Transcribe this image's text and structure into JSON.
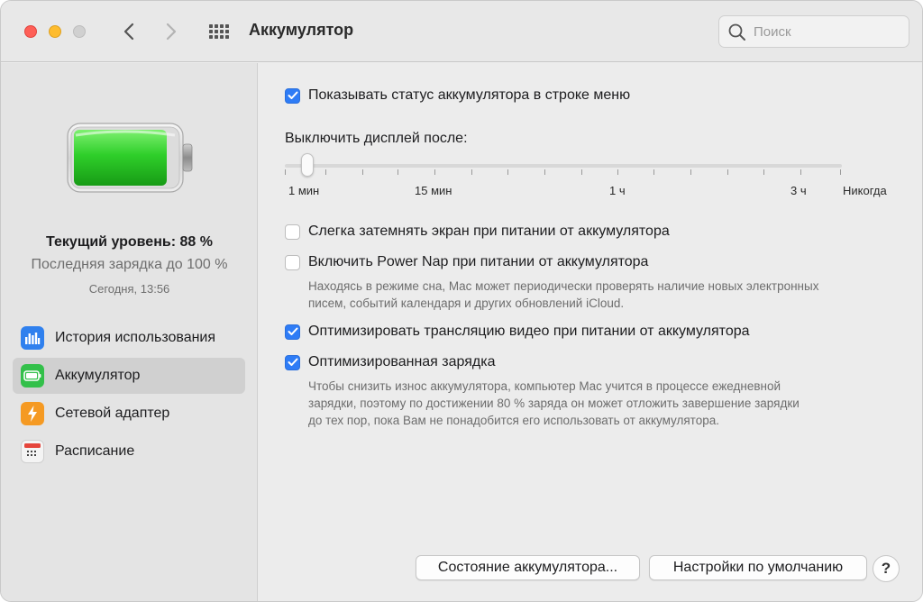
{
  "window": {
    "title": "Аккумулятор"
  },
  "search": {
    "placeholder": "Поиск",
    "value": ""
  },
  "sidebar": {
    "battery_level_percent": 88,
    "level_text": "Текущий уровень: 88 %",
    "last_charge_text": "Последняя зарядка до 100 %",
    "charge_time": "Сегодня, 13:56",
    "items": [
      {
        "label": "История использования",
        "icon": "usage-history-icon",
        "selected": false
      },
      {
        "label": "Аккумулятор",
        "icon": "battery-icon",
        "selected": true
      },
      {
        "label": "Сетевой адаптер",
        "icon": "power-adapter-icon",
        "selected": false
      },
      {
        "label": "Расписание",
        "icon": "calendar-icon",
        "selected": false
      }
    ]
  },
  "main": {
    "show_status": {
      "label": "Показывать статус аккумулятора в строке меню",
      "checked": true
    },
    "display_off": {
      "title": "Выключить дисплей после:",
      "labels": [
        "1 мин",
        "15 мин",
        "1 ч",
        "3 ч",
        "Никогда"
      ],
      "value": "1 мин"
    },
    "dim_screen": {
      "label": "Слегка затемнять экран при питании от аккумулятора",
      "checked": false
    },
    "power_nap": {
      "label": "Включить Power Nap при питании от аккумулятора",
      "checked": false,
      "note_line1": "Находясь в режиме сна, Mac может периодически проверять наличие новых электронных",
      "note_line2": "писем, событий календаря и других обновлений iCloud."
    },
    "optimize_video": {
      "label": "Оптимизировать трансляцию видео при питании от аккумулятора",
      "checked": true
    },
    "optimized_charging": {
      "label": "Оптимизированная зарядка",
      "checked": true,
      "note_line1": "Чтобы снизить износ аккумулятора, компьютер Mac учится в процессе ежедневной",
      "note_line2": "зарядки, поэтому по достижении 80 % заряда он может отложить завершение зарядки",
      "note_line3": "до тех пор, пока Вам не понадобится его использовать от аккумулятора."
    },
    "buttons": {
      "battery_health": "Состояние аккумулятора...",
      "restore_defaults": "Настройки по умолчанию",
      "help": "?"
    }
  },
  "colors": {
    "accent": "#2e7cf6",
    "battery_green": "#2fcf2a",
    "close": "#fe5f57",
    "minimize": "#febc2e"
  }
}
